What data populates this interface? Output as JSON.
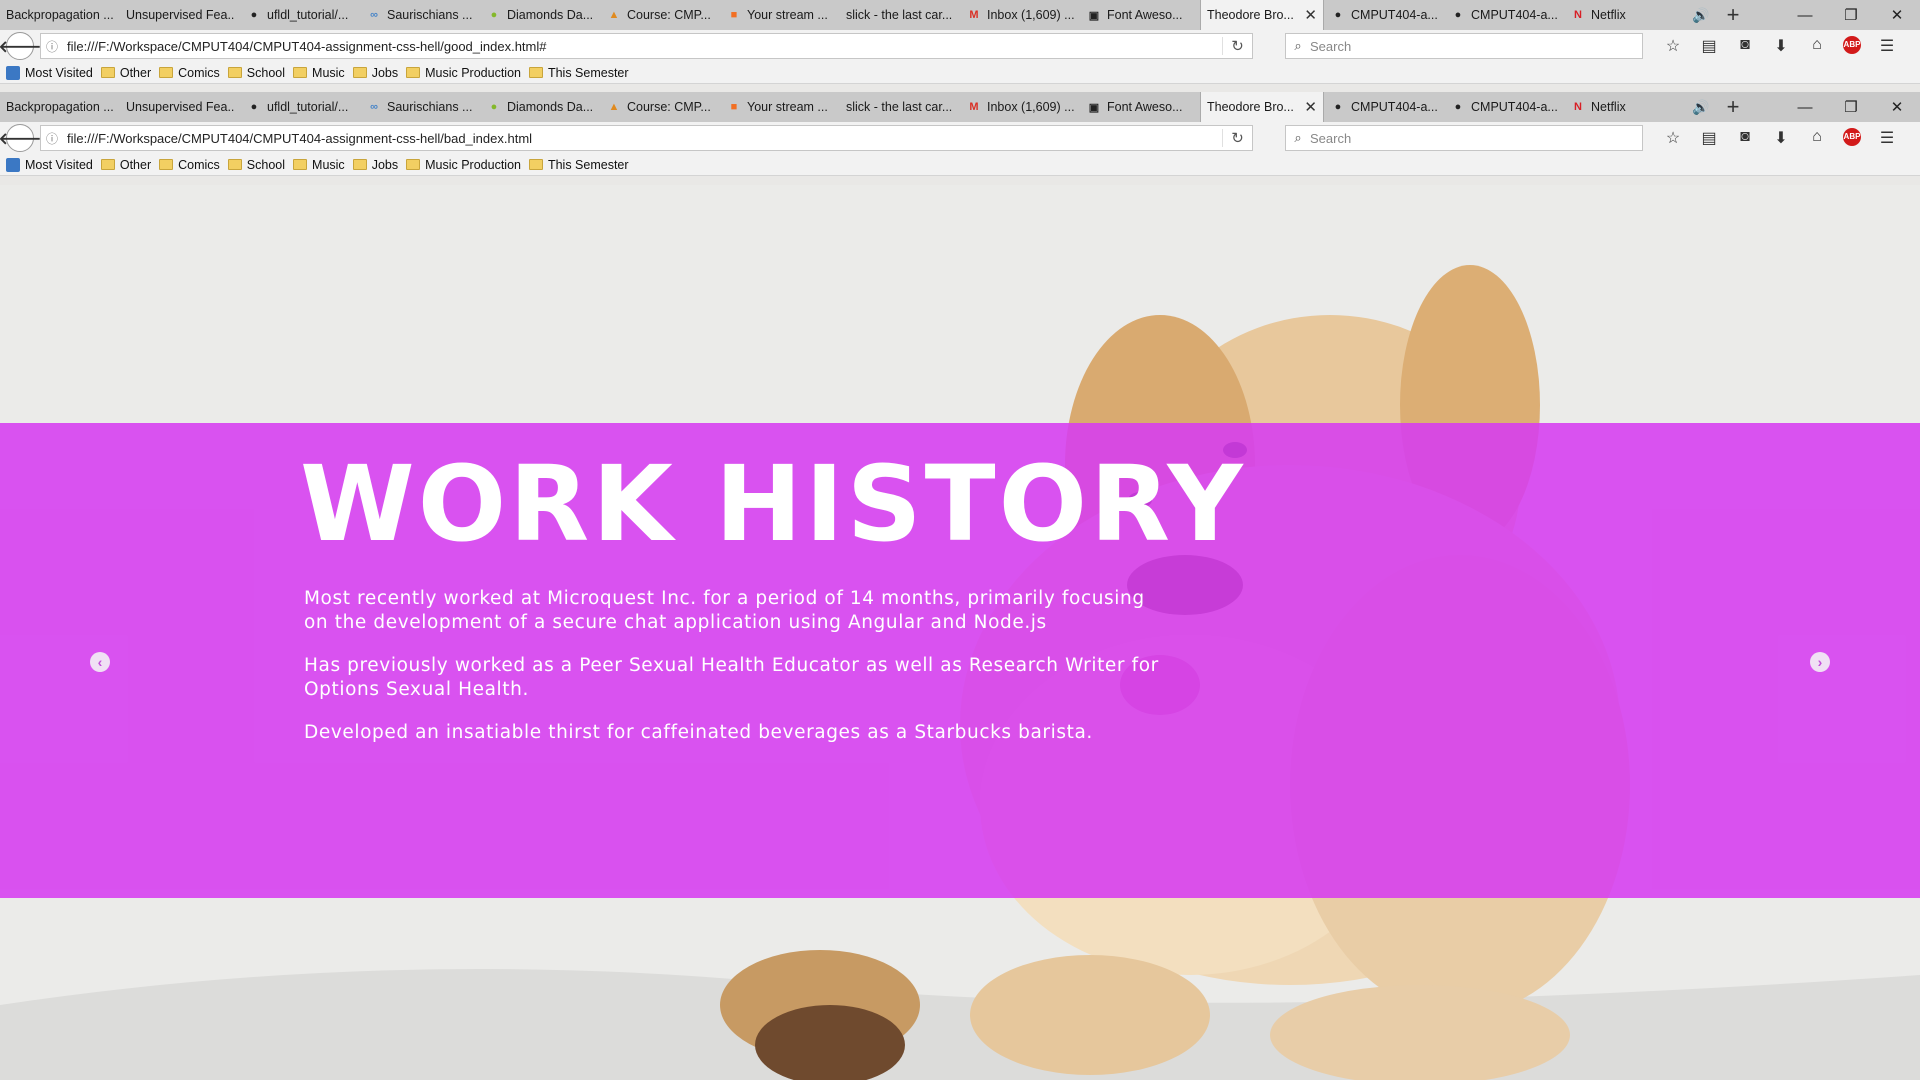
{
  "browser": {
    "tabs": [
      {
        "label": "Backpropagation ...",
        "icon": "none"
      },
      {
        "label": "Unsupervised Fea...",
        "icon": "none"
      },
      {
        "label": "ufldl_tutorial/...",
        "icon": "github-icon"
      },
      {
        "label": "Saurischians ...",
        "icon": "infinity-icon"
      },
      {
        "label": "Diamonds Da...",
        "icon": "spotify-icon"
      },
      {
        "label": "Course: CMP...",
        "icon": "moodle-icon"
      },
      {
        "label": "Your stream ...",
        "icon": "soundcloud-icon"
      },
      {
        "label": "slick - the last car...",
        "icon": "none"
      },
      {
        "label": "Inbox (1,609) ...",
        "icon": "gmail-icon"
      },
      {
        "label": "Font Aweso...",
        "icon": "flag-icon"
      },
      {
        "label": "Theodore Bro...",
        "icon": "none",
        "active": true
      },
      {
        "label": "CMPUT404-a...",
        "icon": "github-icon"
      },
      {
        "label": "CMPUT404-a...",
        "icon": "github-icon"
      },
      {
        "label": "Netflix",
        "icon": "netflix-icon"
      }
    ],
    "search_placeholder": "Search",
    "bookmarks": [
      "Most Visited",
      "Other",
      "Comics",
      "School",
      "Music",
      "Jobs",
      "Music Production",
      "This Semester"
    ]
  },
  "window1": {
    "url": "file:///F:/Workspace/CMPUT404/CMPUT404-assignment-css-hell/good_index.html#"
  },
  "window2": {
    "url": "file:///F:/Workspace/CMPUT404/CMPUT404-assignment-css-hell/bad_index.html"
  },
  "page": {
    "heading": "WORK HISTORY",
    "paragraphs": [
      "Most recently worked at Microquest Inc. for a period of 14 months, primarily focusing on the development of a secure chat application using Angular and Node.js",
      "Has previously worked as a Peer Sexual Health Educator as well as Research Writer for Options Sexual Health.",
      "Developed an insatiable thirst for caffeinated beverages as a Starbucks barista."
    ],
    "prev_arrow": "‹",
    "next_arrow": "›"
  },
  "colors": {
    "band": "#d63cf0",
    "tabbar": "#c9c9c9",
    "toolbar": "#f2f2f2"
  }
}
